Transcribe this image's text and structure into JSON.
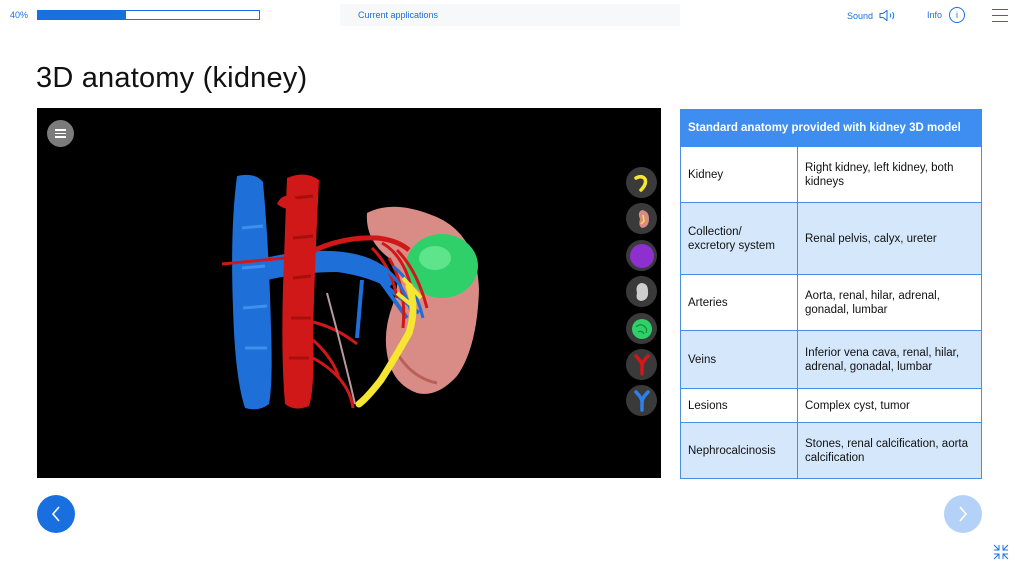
{
  "header": {
    "progress_text": "40%",
    "progress_value": 0.4,
    "current_applications": "Current applications",
    "sound_label": "Sound",
    "info_label": "Info",
    "info_glyph": "i"
  },
  "page": {
    "title": "3D anatomy (kidney)"
  },
  "viewer": {
    "layer_icons": [
      "ureter-layer-icon",
      "kidney-section-layer-icon",
      "lesion-layer-icon",
      "kidney-outline-layer-icon",
      "calcification-layer-icon",
      "arteries-layer-icon",
      "veins-layer-icon"
    ]
  },
  "table": {
    "header": "Standard anatomy provided with kidney 3D model",
    "rows": [
      {
        "label": "Kidney",
        "value": "Right kidney, left kidney, both kidneys"
      },
      {
        "label": "Collection/ excretory system",
        "value": "Renal pelvis, calyx, ureter"
      },
      {
        "label": "Arteries",
        "value": "Aorta, renal, hilar, adrenal, gonadal, lumbar"
      },
      {
        "label": "Veins",
        "value": "Inferior vena cava, renal, hilar, adrenal, gonadal, lumbar"
      },
      {
        "label": "Lesions",
        "value": "Complex cyst, tumor"
      },
      {
        "label": "Nephrocalcinosis",
        "value": "Stones, renal calcification, aorta calcification"
      }
    ]
  },
  "colors": {
    "accent": "#1a6fe0",
    "table_header": "#3d8ef0",
    "table_alt_row": "#d5e7fb",
    "vein_blue": "#1f6fd8",
    "artery_red": "#d01818",
    "kidney_pink": "#d98c86",
    "lesion_green": "#2fd06a",
    "ureter_yellow": "#f5e632"
  }
}
